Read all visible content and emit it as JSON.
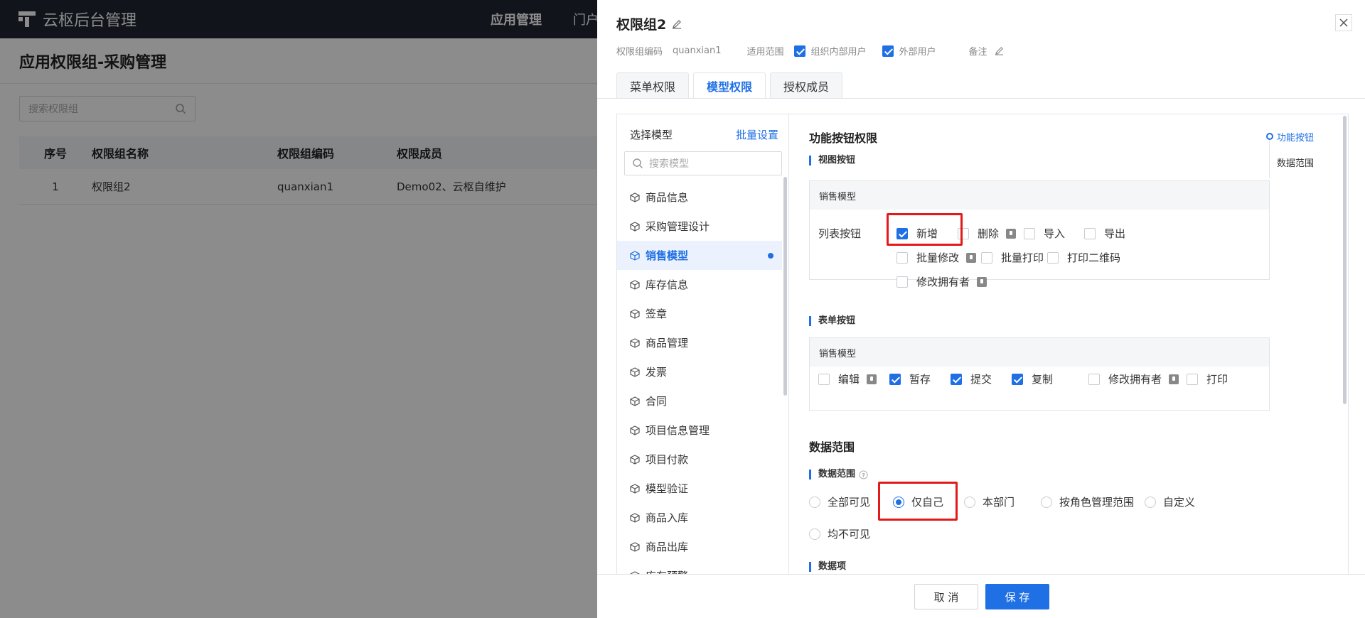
{
  "app": {
    "title": "云枢后台管理",
    "nav": [
      "应用管理",
      "门户"
    ]
  },
  "bg": {
    "page_title": "应用权限组-采购管理",
    "search_placeholder": "搜索权限组",
    "table": {
      "headers": [
        "序号",
        "权限组名称",
        "权限组编码",
        "权限成员"
      ],
      "rows": [
        [
          "1",
          "权限组2",
          "quanxian1",
          "Demo02、云枢自维护"
        ]
      ]
    }
  },
  "drawer": {
    "title": "权限组2",
    "meta": {
      "code_label": "权限组编码",
      "code_value": "quanxian1",
      "scope_label": "适用范围",
      "scope_inner": "组织内部用户",
      "scope_outer": "外部用户",
      "remark_label": "备注"
    },
    "tabs": [
      "菜单权限",
      "模型权限",
      "授权成员"
    ],
    "active_tab": "模型权限",
    "left": {
      "title": "选择模型",
      "batch": "批量设置",
      "search_placeholder": "搜索模型",
      "items": [
        "商品信息",
        "采购管理设计",
        "销售模型",
        "库存信息",
        "签章",
        "商品管理",
        "发票",
        "合同",
        "项目信息管理",
        "项目付款",
        "模型验证",
        "商品入库",
        "商品出库",
        "库存预警"
      ],
      "active": "销售模型"
    },
    "func": {
      "title": "功能按钮权限",
      "view_title": "视图按钮",
      "view_box_head": "销售模型",
      "list_label": "列表按钮",
      "view_opts": [
        {
          "label": "新增",
          "checked": true,
          "lock": false
        },
        {
          "label": "删除",
          "checked": false,
          "lock": true
        },
        {
          "label": "导入",
          "checked": false,
          "lock": false
        },
        {
          "label": "导出",
          "checked": false,
          "lock": false
        },
        {
          "label": "批量修改",
          "checked": false,
          "lock": true
        },
        {
          "label": "批量打印",
          "checked": false,
          "lock": false
        },
        {
          "label": "打印二维码",
          "checked": false,
          "lock": false
        },
        {
          "label": "修改拥有者",
          "checked": false,
          "lock": true
        }
      ],
      "form_title": "表单按钮",
      "form_box_head": "销售模型",
      "form_opts": [
        {
          "label": "编辑",
          "checked": false,
          "lock": true
        },
        {
          "label": "暂存",
          "checked": true,
          "lock": false
        },
        {
          "label": "提交",
          "checked": true,
          "lock": false
        },
        {
          "label": "复制",
          "checked": true,
          "lock": false
        },
        {
          "label": "修改拥有者",
          "checked": false,
          "lock": true
        },
        {
          "label": "打印",
          "checked": false,
          "lock": false
        }
      ]
    },
    "scope": {
      "title": "数据范围",
      "sub_title": "数据范围",
      "options": [
        "全部可见",
        "仅自己",
        "本部门",
        "按角色管理范围",
        "自定义",
        "均不可见"
      ],
      "selected": "仅自己",
      "next_sub": "数据项"
    },
    "anchor": [
      "功能按钮",
      "数据范围"
    ],
    "footer": {
      "cancel": "取 消",
      "save": "保 存"
    }
  },
  "colors": {
    "primary": "#1f6fe5",
    "highlight": "#e31a1a",
    "topbar": "#1f2532"
  }
}
